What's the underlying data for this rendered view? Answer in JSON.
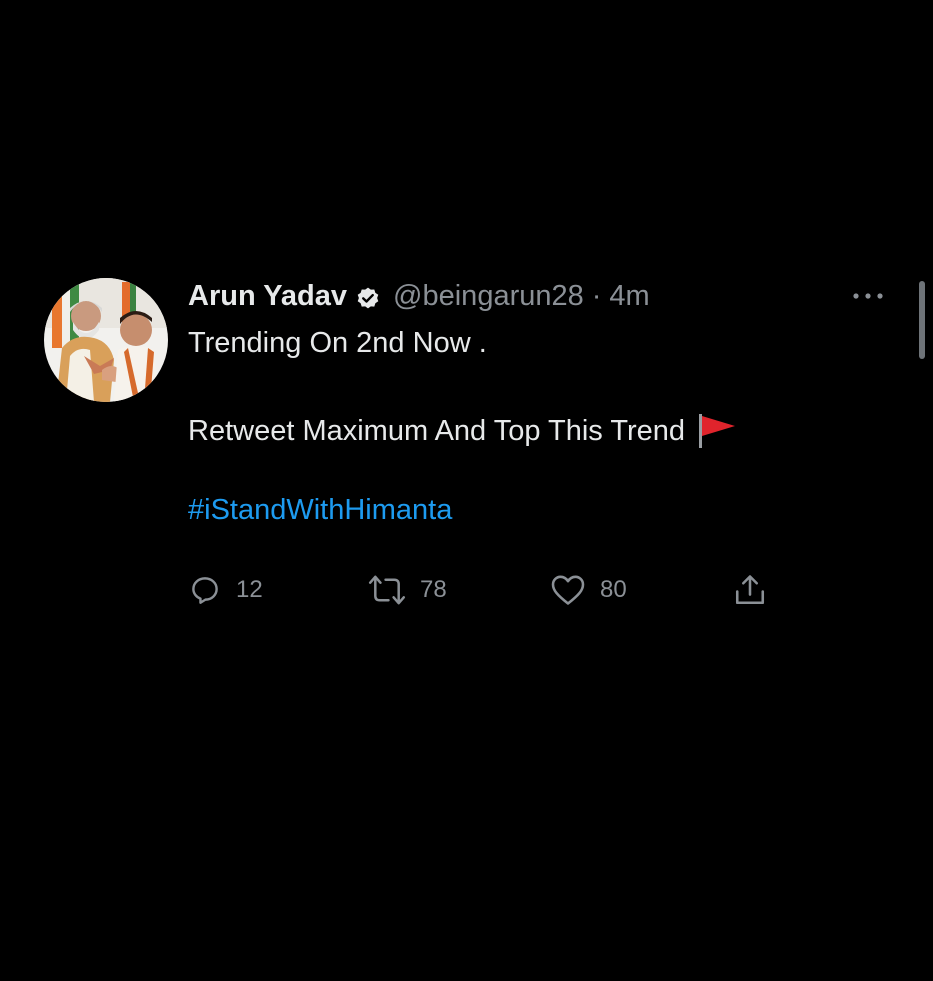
{
  "tweet": {
    "author_name": "Arun Yadav",
    "handle": "@beingarun28",
    "separator": "·",
    "timestamp": "4m",
    "line1": "Trending On 2nd Now .",
    "line2": "Retweet Maximum And Top This Trend",
    "hashtag": "#iStandWithHimanta",
    "flag_emoji": "triangular-flag-icon"
  },
  "actions": {
    "replies": "12",
    "retweets": "78",
    "likes": "80"
  },
  "colors": {
    "background": "#000000",
    "text": "#e7e9ea",
    "secondary": "#8b9096",
    "link": "#1d9bf0",
    "flag": "#e0242c"
  }
}
